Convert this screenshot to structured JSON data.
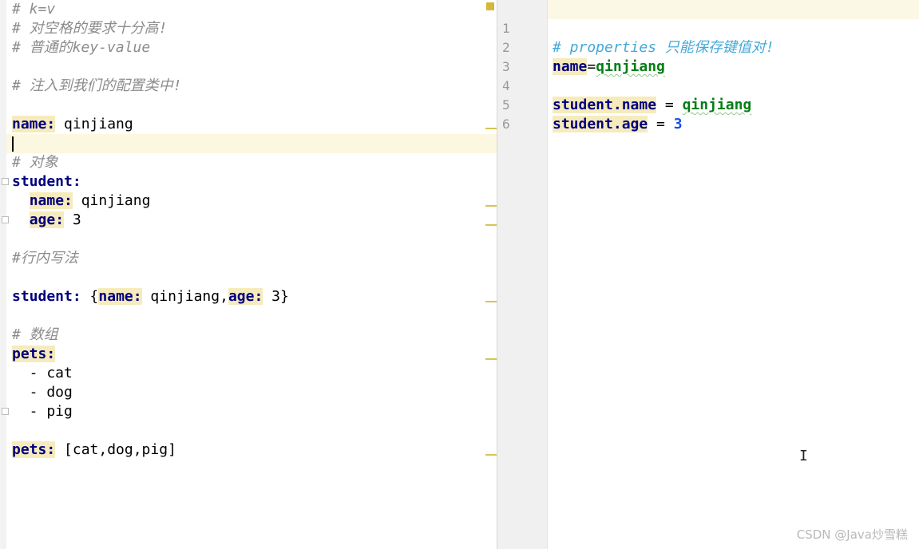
{
  "left_editor": {
    "lines": [
      {
        "comment": "# k=v"
      },
      {
        "comment": "# 对空格的要求十分高!"
      },
      {
        "comment": "# 普通的key-value"
      },
      {},
      {
        "comment": "# 注入到我们的配置类中!"
      },
      {},
      {
        "key": "name:",
        "value": " qinjiang"
      },
      {},
      {
        "comment": "# 对象"
      },
      {
        "key": "student:"
      },
      {
        "indent": "  ",
        "key": "name:",
        "value": " qinjiang"
      },
      {
        "indent": "  ",
        "key": "age:",
        "value": " 3"
      },
      {},
      {
        "comment": "#行内写法"
      },
      {},
      {
        "inline_student": {
          "key": "student:",
          "open": " {",
          "k1": "name:",
          "v1": " qinjiang,",
          "k2": "age:",
          "v2": " 3}"
        }
      },
      {},
      {
        "comment": "# 数组"
      },
      {
        "key": "pets:"
      },
      {
        "value": "  - cat"
      },
      {
        "value": "  - dog"
      },
      {
        "value": "  - pig"
      },
      {},
      {
        "key": "pets:",
        "value": " [cat,dog,pig]"
      }
    ]
  },
  "right_editor": {
    "line_numbers": [
      "1",
      "2",
      "3",
      "4",
      "5",
      "6"
    ],
    "lines": [
      {
        "comment": "# properties 只能保存键值对!"
      },
      {
        "key": "name",
        "op": "=",
        "value": "qinjiang"
      },
      {},
      {
        "key": "student.name",
        "op": " = ",
        "value": "qinjiang"
      },
      {
        "key": "student.age",
        "op": " = ",
        "num": "3"
      },
      {}
    ]
  },
  "watermark": "CSDN @Java炒雪糕",
  "colors": {
    "key": "#000080",
    "key_highlight": "#f6ebbc",
    "comment_left": "#8c8c8c",
    "comment_right": "#45a8d8",
    "string_value": "#067d17",
    "number_value": "#1750eb",
    "caret_line": "#fcf7e0"
  },
  "icons": [
    "text-cursor-icon",
    "warning-marker-icon",
    "fold-marker-icon"
  ]
}
